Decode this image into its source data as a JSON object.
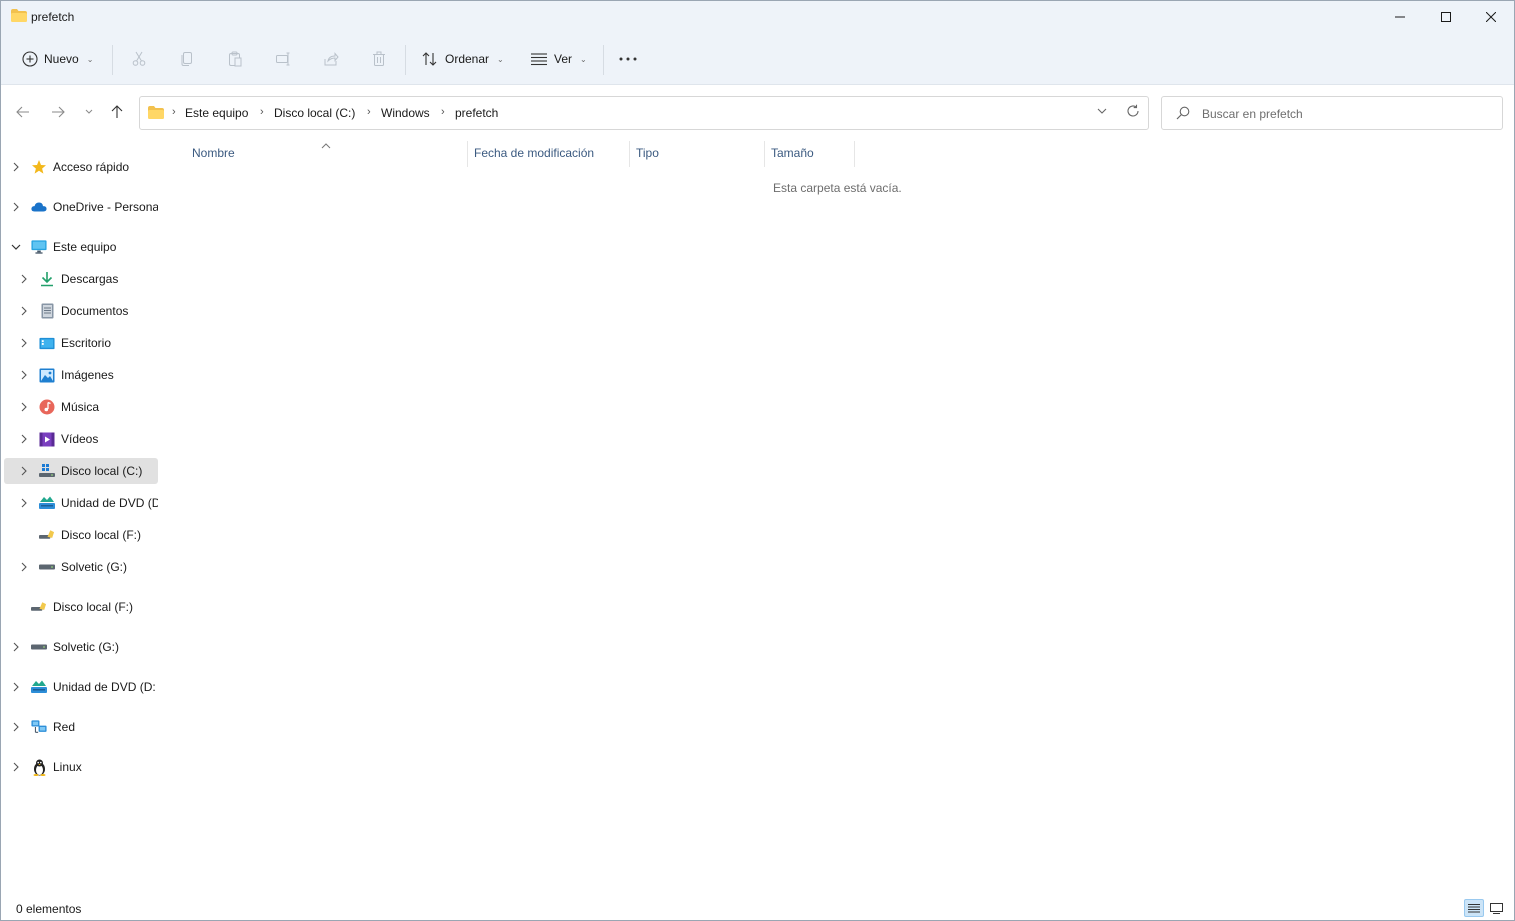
{
  "window": {
    "title": "prefetch"
  },
  "toolbar": {
    "new_label": "Nuevo",
    "sort_label": "Ordenar",
    "view_label": "Ver",
    "icons": [
      "cut-icon",
      "copy-icon",
      "paste-icon",
      "rename-icon",
      "share-icon",
      "delete-icon"
    ]
  },
  "address": {
    "crumbs": [
      "Este equipo",
      "Disco local (C:)",
      "Windows",
      "prefetch"
    ]
  },
  "search": {
    "placeholder": "Buscar en prefetch"
  },
  "nav": {
    "items": [
      {
        "label": "Acceso rápido",
        "icon": "star-icon"
      },
      {
        "label": "OneDrive - Persona",
        "icon": "cloud-icon"
      },
      {
        "label": "Este equipo",
        "icon": "monitor-icon"
      },
      {
        "label": "Descargas",
        "icon": "download-icon"
      },
      {
        "label": "Documentos",
        "icon": "document-icon"
      },
      {
        "label": "Escritorio",
        "icon": "desktop-icon"
      },
      {
        "label": "Imágenes",
        "icon": "pictures-icon"
      },
      {
        "label": "Música",
        "icon": "music-icon"
      },
      {
        "label": "Vídeos",
        "icon": "videos-icon"
      },
      {
        "label": "Disco local (C:)",
        "icon": "windows-drive-icon"
      },
      {
        "label": "Unidad de DVD (D",
        "icon": "dvd-drive-icon"
      },
      {
        "label": "Disco local (F:)",
        "icon": "usb-drive-icon"
      },
      {
        "label": "Solvetic (G:)",
        "icon": "drive-icon"
      },
      {
        "label": "Disco local (F:)",
        "icon": "usb-drive-icon"
      },
      {
        "label": "Solvetic (G:)",
        "icon": "drive-icon"
      },
      {
        "label": "Unidad de DVD (D:",
        "icon": "dvd-drive-icon"
      },
      {
        "label": "Red",
        "icon": "network-icon"
      },
      {
        "label": "Linux",
        "icon": "linux-penguin-icon"
      }
    ]
  },
  "columns": {
    "name": "Nombre",
    "modified": "Fecha de modificación",
    "type": "Tipo",
    "size": "Tamaño"
  },
  "content": {
    "empty_message": "Esta carpeta está vacía."
  },
  "status": {
    "count": "0 elementos"
  },
  "colors": {
    "chrome_bg": "#eef3f9",
    "folder_yellow": "#f2c14e",
    "header_text": "#3b5a80",
    "selected_bg": "#e1e1e1"
  }
}
